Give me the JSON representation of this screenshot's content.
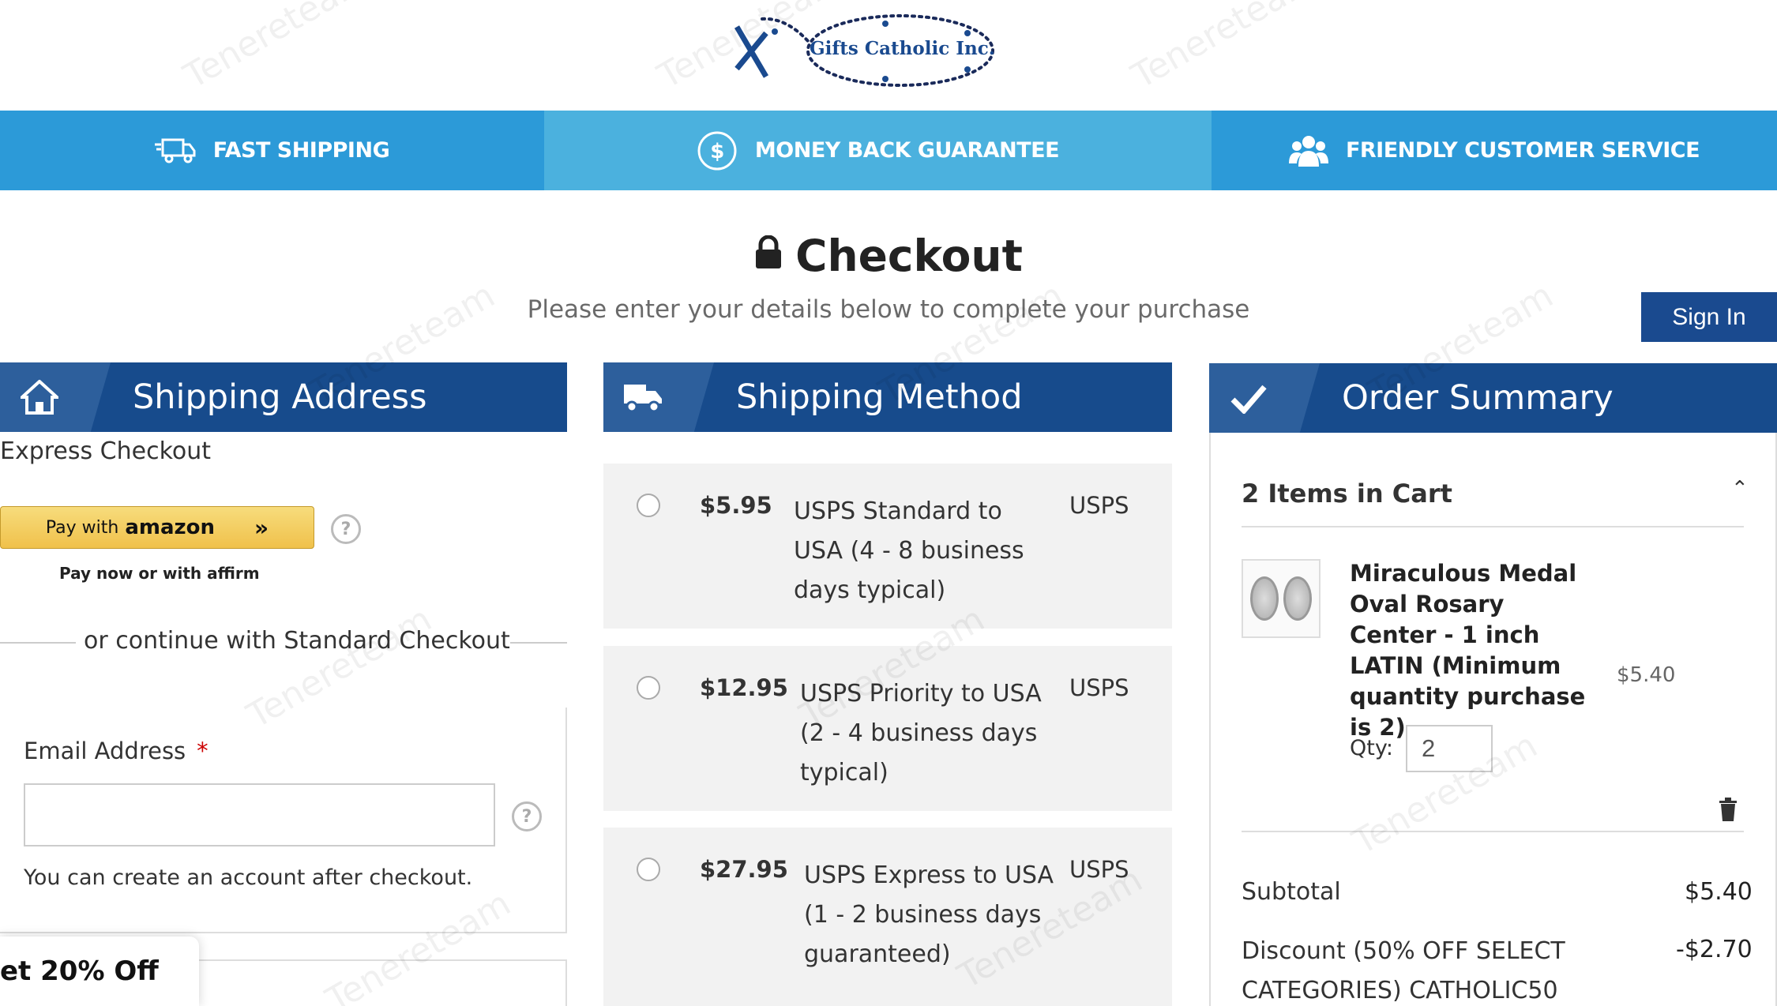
{
  "logo": {
    "text": "Gifts Catholic Inc."
  },
  "promo": {
    "fast_shipping": "FAST SHIPPING",
    "money_back": "MONEY BACK GUARANTEE",
    "customer_service": "FRIENDLY CUSTOMER SERVICE"
  },
  "page": {
    "title": "Checkout",
    "subtitle": "Please enter your details below to complete your purchase",
    "sign_in": "Sign In"
  },
  "shipping_address": {
    "header": "Shipping Address",
    "express_label": "Express Checkout",
    "amazon_prefix": "Pay with",
    "amazon_brand": "amazon",
    "affirm_text": "Pay now or with affirm",
    "or_text": "or continue with Standard Checkout",
    "email_label": "Email Address",
    "required_mark": "*",
    "email_value": "",
    "email_note": "You can create an account after checkout.",
    "popup": "et 20% Off"
  },
  "shipping_method": {
    "header": "Shipping Method",
    "options": [
      {
        "price": "$5.95",
        "desc": "USPS Standard to USA (4 - 8 business days typical)",
        "carrier": "USPS"
      },
      {
        "price": "$12.95",
        "desc": "USPS Priority to USA (2 - 4 business days typical)",
        "carrier": "USPS"
      },
      {
        "price": "$27.95",
        "desc": "USPS Express to USA (1 - 2 business days guaranteed)",
        "carrier": "USPS"
      }
    ]
  },
  "order_summary": {
    "header": "Order Summary",
    "items_title": "2 Items in Cart",
    "item": {
      "name": "Miraculous Medal Oval Rosary Center - 1 inch LATIN (Minimum quantity purchase is 2)",
      "price": "$5.40",
      "qty_label": "Qty:",
      "qty": "2"
    },
    "subtotal_label": "Subtotal",
    "subtotal": "$5.40",
    "discount_label": "Discount (50% OFF SELECT CATEGORIES) CATHOLIC50",
    "discount": "-$2.70"
  },
  "watermark": "Tenereteam",
  "colors": {
    "promo_blue": "#2c9ad8",
    "promo_light": "#4bb1de",
    "header_navy": "#174b8c",
    "method_bg": "#f2f2f2"
  }
}
